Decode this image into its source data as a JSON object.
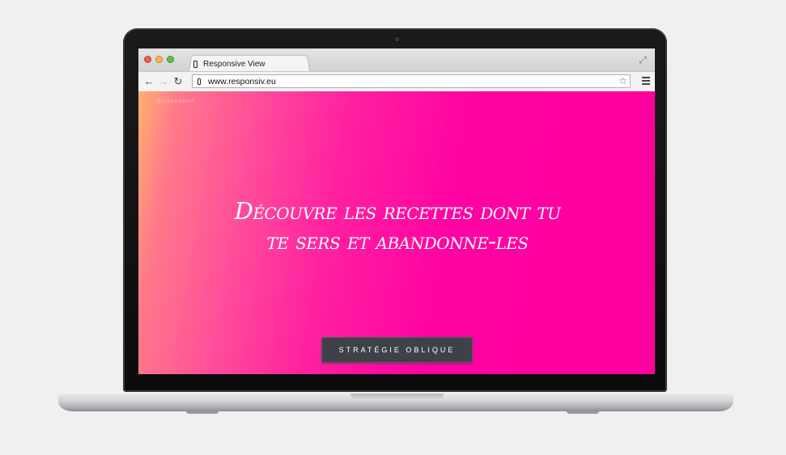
{
  "browser": {
    "tab_title": "Responsive View",
    "url": "www.responsiv.eu"
  },
  "icons": {
    "back": "arrow-left-icon",
    "forward": "arrow-right-icon",
    "reload": "reload-icon",
    "bookmark": "star-icon",
    "menu": "hamburger-menu-icon",
    "fullscreen": "fullscreen-icon"
  },
  "page": {
    "credit": "@clairedonvl",
    "headline": "Découvre les recettes dont tu te sers et abandonne-les",
    "cta_label": "STRATÉGIE OBLIQUE"
  },
  "colors": {
    "gradient_start": "#ffb070",
    "gradient_end": "#ff00a0",
    "button_bg": "#3e4248"
  }
}
